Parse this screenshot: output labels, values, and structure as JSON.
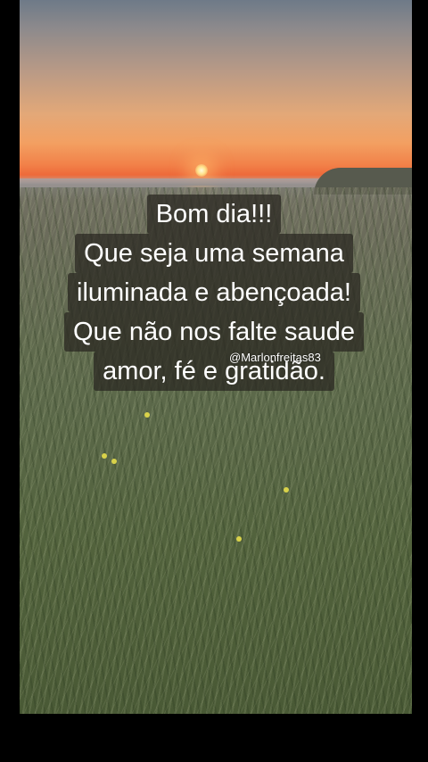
{
  "caption": {
    "line1": "Bom dia!!!",
    "line2": "Que seja uma semana",
    "line3": "iluminada e abençoada!",
    "line4": "Que não nos falte saude",
    "line5": "amor, fé e gratidão."
  },
  "watermark": "@Marlonfreitas83",
  "colors": {
    "caption_background": "#28261f",
    "caption_text": "#ffffff",
    "frame": "#000000"
  }
}
